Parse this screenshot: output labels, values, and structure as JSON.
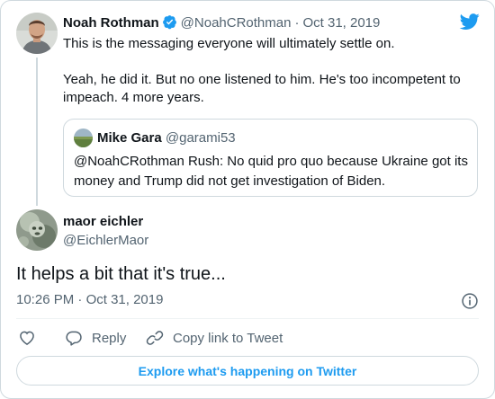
{
  "colors": {
    "accent": "#1d9bf0",
    "text": "#0f1419",
    "muted": "#536471",
    "border": "#cfd9de"
  },
  "parent_tweet": {
    "author_name": "Noah Rothman",
    "verified": true,
    "handle": "@NoahCRothman",
    "separator": "·",
    "date": "Oct 31, 2019",
    "text_line1": "This is the messaging everyone will ultimately settle on.",
    "text_line2": "Yeah, he did it. But no one listened to him. He's too incompetent to impeach. 4 more years.",
    "quoted": {
      "author_name": "Mike Gara",
      "handle": "@garami53",
      "text": "@NoahCRothman Rush: No quid pro quo because Ukraine got its money and Trump did not get investigation of Biden."
    }
  },
  "reply_tweet": {
    "author_name": "maor eichler",
    "handle": "@EichlerMaor",
    "text": "It helps a bit that it's true...",
    "time": "10:26 PM",
    "separator": "·",
    "date": "Oct 31, 2019"
  },
  "actions": {
    "like_icon": "heart-icon",
    "reply_label": "Reply",
    "copy_label": "Copy link to Tweet"
  },
  "explore_label": "Explore what's happening on Twitter"
}
